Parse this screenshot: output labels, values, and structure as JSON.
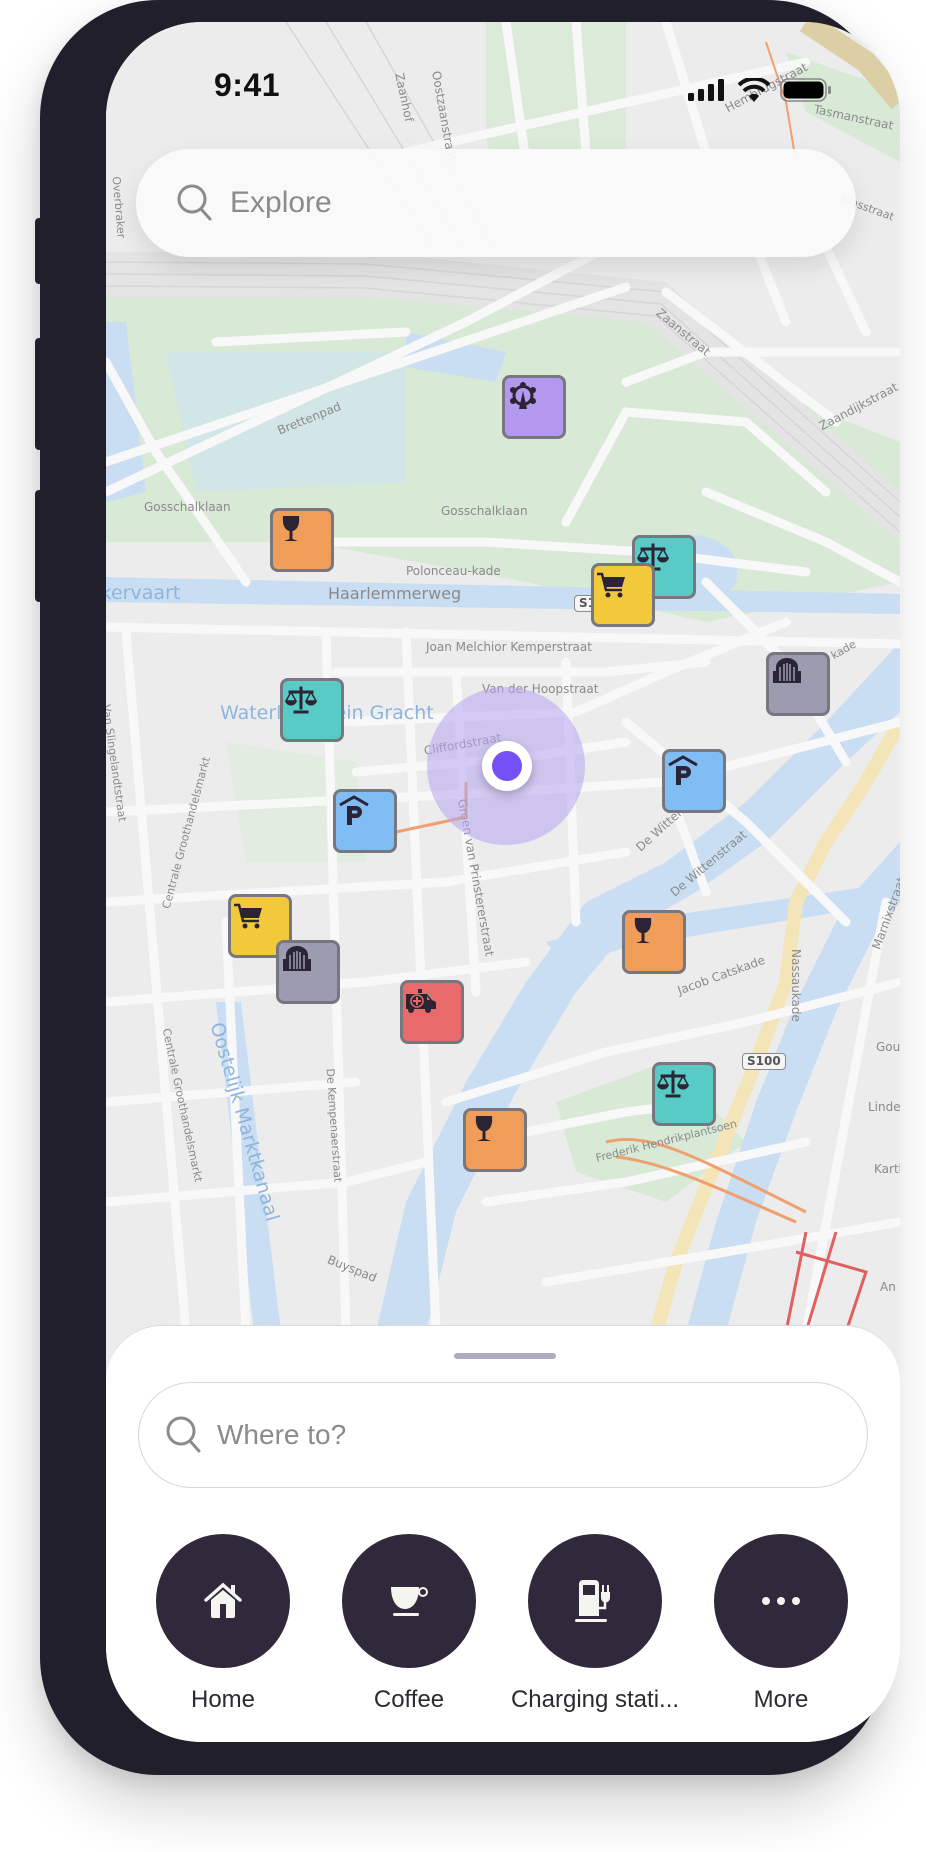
{
  "status_bar": {
    "time": "9:41",
    "signal_icon": "cellular-signal-icon",
    "wifi_icon": "wifi-icon",
    "battery_icon": "battery-full-icon"
  },
  "explore_search": {
    "icon": "search-icon",
    "placeholder": "Explore"
  },
  "map": {
    "road_labels": [
      "Zaanhof",
      "Oostzaanstraat",
      "Hembrugstraat",
      "Tasmanstraat",
      "Zaanstraat",
      "Zaandijkstraat",
      "Brettenpad",
      "Gosschalklaan",
      "Gosschalklaan",
      "Polonceau-kade",
      "Haarlemmerweg",
      "Joan Melchior Kemperstraat",
      "Van der Hoopstraat",
      "Cliffordstraat",
      "Groen van Prinstererstraat",
      "De Wittenkade",
      "De Wittenstraat",
      "Jacob Catskade",
      "Nassaukade",
      "Marnixstraat",
      "Van Slingelandtstraat",
      "Centrale Groothandelsmarkt",
      "Centrale Groothandelsmarkt",
      "De Kempenaerstraat",
      "Buyspad",
      "Frederik Hendrikplantsoen",
      "Gou",
      "Lindeng",
      "Karth",
      "An",
      "Overbraker",
      "blasstraat",
      "kade"
    ],
    "water_labels": [
      "Westergasfabriekervaart",
      "Waterlandplein Gracht",
      "Oostelijk Marktkanaal"
    ],
    "road_shields": [
      "S103",
      "S100"
    ],
    "colors": {
      "land": "#ececec",
      "park": "#d8e9d6",
      "water": "#c9def3",
      "road": "#f8f8f8",
      "highway": "#f3e5b8",
      "cycle_path": "#f0a070",
      "tram": "#e06060"
    },
    "markers": [
      {
        "type": "amusement-park",
        "icon": "ferris-wheel-icon",
        "color": "#b497ee"
      },
      {
        "type": "bar",
        "icon": "wine-glass-icon",
        "color": "#f09d59"
      },
      {
        "type": "courthouse",
        "icon": "scales-icon",
        "color": "#58cbc6"
      },
      {
        "type": "shop",
        "icon": "shopping-cart-icon",
        "color": "#f2c93b"
      },
      {
        "type": "gate",
        "icon": "gate-icon",
        "color": "#9c9cb1"
      },
      {
        "type": "courthouse",
        "icon": "scales-icon",
        "color": "#58cbc6"
      },
      {
        "type": "parking",
        "icon": "parking-garage-icon",
        "color": "#80bdf5"
      },
      {
        "type": "parking",
        "icon": "parking-garage-icon",
        "color": "#80bdf5"
      },
      {
        "type": "shop",
        "icon": "shopping-cart-icon",
        "color": "#f2c93b"
      },
      {
        "type": "gate",
        "icon": "gate-icon",
        "color": "#9c9cb1"
      },
      {
        "type": "bar",
        "icon": "wine-glass-icon",
        "color": "#f09d59"
      },
      {
        "type": "hospital",
        "icon": "ambulance-icon",
        "color": "#e86a6a"
      },
      {
        "type": "courthouse",
        "icon": "scales-icon",
        "color": "#58cbc6"
      },
      {
        "type": "bar",
        "icon": "wine-glass-icon",
        "color": "#f09d59"
      }
    ],
    "user_location": {
      "dot_color": "#7550f5",
      "halo_color": "#b7a6f0"
    }
  },
  "bottom_sheet": {
    "search": {
      "icon": "search-icon",
      "placeholder": "Where to?"
    },
    "shortcuts": [
      {
        "label": "Home",
        "icon": "home-icon"
      },
      {
        "label": "Coffee",
        "icon": "coffee-cup-icon"
      },
      {
        "label": "Charging stati...",
        "icon": "ev-charging-station-icon"
      },
      {
        "label": "More",
        "icon": "more-horizontal-icon"
      }
    ],
    "shortcut_color": "#30293b"
  }
}
